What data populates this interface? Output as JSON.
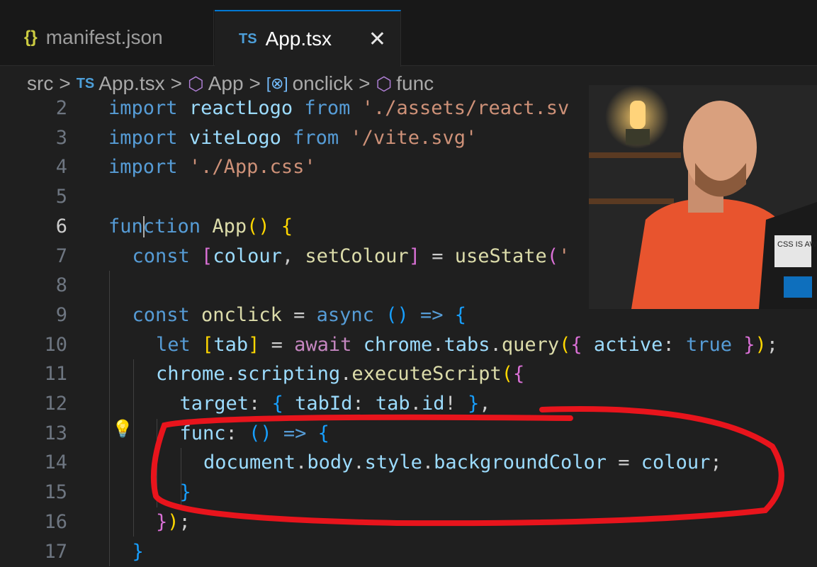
{
  "tabs": [
    {
      "icon": "{}",
      "label": "manifest.json"
    },
    {
      "icon": "TS",
      "label": "App.tsx",
      "close": "✕"
    }
  ],
  "breadcrumb": {
    "src": "src",
    "file_icon": "TS",
    "file": "App.tsx",
    "symbol1": "App",
    "symbol2": "onclick",
    "symbol3": "func",
    "separator": ">"
  },
  "code_lines": [
    {
      "n": "2",
      "text": "import reactLogo from './assets/react.sv"
    },
    {
      "n": "3",
      "text": "import viteLogo from '/vite.svg'"
    },
    {
      "n": "4",
      "text": "import './App.css'"
    },
    {
      "n": "5",
      "text": ""
    },
    {
      "n": "6",
      "text": "function App() {"
    },
    {
      "n": "7",
      "text": "const [colour, setColour] = useState('"
    },
    {
      "n": "8",
      "text": ""
    },
    {
      "n": "9",
      "text": "const onclick = async () => {"
    },
    {
      "n": "10",
      "text": "let [tab] = await chrome.tabs.query({ active: true });"
    },
    {
      "n": "11",
      "text": "chrome.scripting.executeScript({"
    },
    {
      "n": "12",
      "text": "target: { tabId: tab.id! },"
    },
    {
      "n": "13",
      "text": "func: () => {"
    },
    {
      "n": "14",
      "text": "document.body.style.backgroundColor = colour;"
    },
    {
      "n": "15",
      "text": "}"
    },
    {
      "n": "16",
      "text": "});"
    },
    {
      "n": "17",
      "text": "}"
    }
  ],
  "active_line": "6",
  "webcam": {
    "laptop_sticker": "CSS IS AWESOME"
  },
  "colors": {
    "annotation": "#e8141c",
    "tab_accent": "#0078d4",
    "background": "#1f1f1f"
  }
}
